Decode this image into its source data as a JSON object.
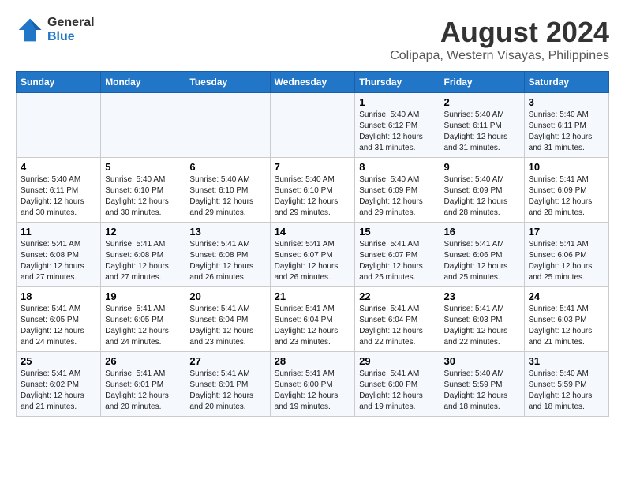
{
  "logo": {
    "line1": "General",
    "line2": "Blue"
  },
  "title": "August 2024",
  "subtitle": "Colipapa, Western Visayas, Philippines",
  "days_of_week": [
    "Sunday",
    "Monday",
    "Tuesday",
    "Wednesday",
    "Thursday",
    "Friday",
    "Saturday"
  ],
  "weeks": [
    [
      {
        "num": "",
        "info": ""
      },
      {
        "num": "",
        "info": ""
      },
      {
        "num": "",
        "info": ""
      },
      {
        "num": "",
        "info": ""
      },
      {
        "num": "1",
        "info": "Sunrise: 5:40 AM\nSunset: 6:12 PM\nDaylight: 12 hours\nand 31 minutes."
      },
      {
        "num": "2",
        "info": "Sunrise: 5:40 AM\nSunset: 6:11 PM\nDaylight: 12 hours\nand 31 minutes."
      },
      {
        "num": "3",
        "info": "Sunrise: 5:40 AM\nSunset: 6:11 PM\nDaylight: 12 hours\nand 31 minutes."
      }
    ],
    [
      {
        "num": "4",
        "info": "Sunrise: 5:40 AM\nSunset: 6:11 PM\nDaylight: 12 hours\nand 30 minutes."
      },
      {
        "num": "5",
        "info": "Sunrise: 5:40 AM\nSunset: 6:10 PM\nDaylight: 12 hours\nand 30 minutes."
      },
      {
        "num": "6",
        "info": "Sunrise: 5:40 AM\nSunset: 6:10 PM\nDaylight: 12 hours\nand 29 minutes."
      },
      {
        "num": "7",
        "info": "Sunrise: 5:40 AM\nSunset: 6:10 PM\nDaylight: 12 hours\nand 29 minutes."
      },
      {
        "num": "8",
        "info": "Sunrise: 5:40 AM\nSunset: 6:09 PM\nDaylight: 12 hours\nand 29 minutes."
      },
      {
        "num": "9",
        "info": "Sunrise: 5:40 AM\nSunset: 6:09 PM\nDaylight: 12 hours\nand 28 minutes."
      },
      {
        "num": "10",
        "info": "Sunrise: 5:41 AM\nSunset: 6:09 PM\nDaylight: 12 hours\nand 28 minutes."
      }
    ],
    [
      {
        "num": "11",
        "info": "Sunrise: 5:41 AM\nSunset: 6:08 PM\nDaylight: 12 hours\nand 27 minutes."
      },
      {
        "num": "12",
        "info": "Sunrise: 5:41 AM\nSunset: 6:08 PM\nDaylight: 12 hours\nand 27 minutes."
      },
      {
        "num": "13",
        "info": "Sunrise: 5:41 AM\nSunset: 6:08 PM\nDaylight: 12 hours\nand 26 minutes."
      },
      {
        "num": "14",
        "info": "Sunrise: 5:41 AM\nSunset: 6:07 PM\nDaylight: 12 hours\nand 26 minutes."
      },
      {
        "num": "15",
        "info": "Sunrise: 5:41 AM\nSunset: 6:07 PM\nDaylight: 12 hours\nand 25 minutes."
      },
      {
        "num": "16",
        "info": "Sunrise: 5:41 AM\nSunset: 6:06 PM\nDaylight: 12 hours\nand 25 minutes."
      },
      {
        "num": "17",
        "info": "Sunrise: 5:41 AM\nSunset: 6:06 PM\nDaylight: 12 hours\nand 25 minutes."
      }
    ],
    [
      {
        "num": "18",
        "info": "Sunrise: 5:41 AM\nSunset: 6:05 PM\nDaylight: 12 hours\nand 24 minutes."
      },
      {
        "num": "19",
        "info": "Sunrise: 5:41 AM\nSunset: 6:05 PM\nDaylight: 12 hours\nand 24 minutes."
      },
      {
        "num": "20",
        "info": "Sunrise: 5:41 AM\nSunset: 6:04 PM\nDaylight: 12 hours\nand 23 minutes."
      },
      {
        "num": "21",
        "info": "Sunrise: 5:41 AM\nSunset: 6:04 PM\nDaylight: 12 hours\nand 23 minutes."
      },
      {
        "num": "22",
        "info": "Sunrise: 5:41 AM\nSunset: 6:04 PM\nDaylight: 12 hours\nand 22 minutes."
      },
      {
        "num": "23",
        "info": "Sunrise: 5:41 AM\nSunset: 6:03 PM\nDaylight: 12 hours\nand 22 minutes."
      },
      {
        "num": "24",
        "info": "Sunrise: 5:41 AM\nSunset: 6:03 PM\nDaylight: 12 hours\nand 21 minutes."
      }
    ],
    [
      {
        "num": "25",
        "info": "Sunrise: 5:41 AM\nSunset: 6:02 PM\nDaylight: 12 hours\nand 21 minutes."
      },
      {
        "num": "26",
        "info": "Sunrise: 5:41 AM\nSunset: 6:01 PM\nDaylight: 12 hours\nand 20 minutes."
      },
      {
        "num": "27",
        "info": "Sunrise: 5:41 AM\nSunset: 6:01 PM\nDaylight: 12 hours\nand 20 minutes."
      },
      {
        "num": "28",
        "info": "Sunrise: 5:41 AM\nSunset: 6:00 PM\nDaylight: 12 hours\nand 19 minutes."
      },
      {
        "num": "29",
        "info": "Sunrise: 5:41 AM\nSunset: 6:00 PM\nDaylight: 12 hours\nand 19 minutes."
      },
      {
        "num": "30",
        "info": "Sunrise: 5:40 AM\nSunset: 5:59 PM\nDaylight: 12 hours\nand 18 minutes."
      },
      {
        "num": "31",
        "info": "Sunrise: 5:40 AM\nSunset: 5:59 PM\nDaylight: 12 hours\nand 18 minutes."
      }
    ]
  ]
}
